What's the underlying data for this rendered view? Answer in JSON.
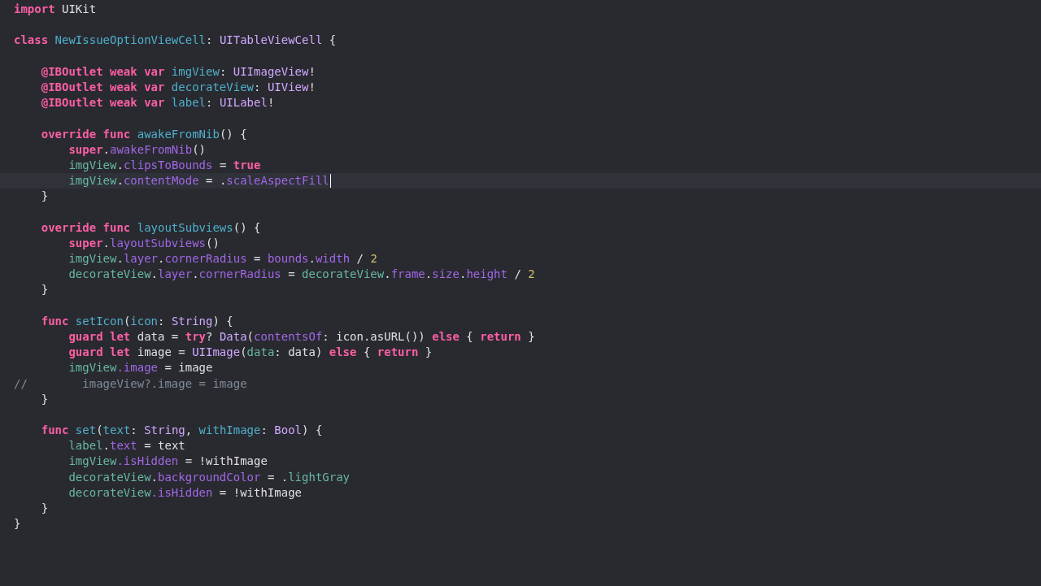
{
  "editor": {
    "lines": [
      {
        "kind": "code",
        "cursor": false,
        "tokens": [
          {
            "text": "import",
            "kind": "kw"
          },
          {
            "text": " UIKit",
            "kind": "plain"
          }
        ]
      },
      {
        "kind": "blank"
      },
      {
        "kind": "code",
        "cursor": false,
        "tokens": [
          {
            "text": "class",
            "kind": "kw"
          },
          {
            "text": " NewIssueOptionViewCell",
            "kind": "decl"
          },
          {
            "text": ": ",
            "kind": "plain"
          },
          {
            "text": "UITableViewCell",
            "kind": "type"
          },
          {
            "text": " {",
            "kind": "plain"
          }
        ]
      },
      {
        "kind": "blank"
      },
      {
        "kind": "code",
        "cursor": false,
        "tokens": [
          {
            "text": "    @IBOutlet weak var",
            "kind": "kw"
          },
          {
            "text": " imgView",
            "kind": "decl"
          },
          {
            "text": ": ",
            "kind": "plain"
          },
          {
            "text": "UIImageView",
            "kind": "type"
          },
          {
            "text": "!",
            "kind": "plain"
          }
        ]
      },
      {
        "kind": "code",
        "cursor": false,
        "tokens": [
          {
            "text": "    @IBOutlet weak var",
            "kind": "kw"
          },
          {
            "text": " decorateView",
            "kind": "decl"
          },
          {
            "text": ": ",
            "kind": "plain"
          },
          {
            "text": "UIView",
            "kind": "type"
          },
          {
            "text": "!",
            "kind": "plain"
          }
        ]
      },
      {
        "kind": "code",
        "cursor": false,
        "tokens": [
          {
            "text": "    @IBOutlet weak var",
            "kind": "kw"
          },
          {
            "text": " label",
            "kind": "decl"
          },
          {
            "text": ": ",
            "kind": "plain"
          },
          {
            "text": "UILabel",
            "kind": "type"
          },
          {
            "text": "!",
            "kind": "plain"
          }
        ]
      },
      {
        "kind": "blank"
      },
      {
        "kind": "code",
        "cursor": false,
        "tokens": [
          {
            "text": "    override func",
            "kind": "kw"
          },
          {
            "text": " awakeFromNib",
            "kind": "decl"
          },
          {
            "text": "() {",
            "kind": "plain"
          }
        ]
      },
      {
        "kind": "code",
        "cursor": false,
        "tokens": [
          {
            "text": "        super",
            "kind": "kw"
          },
          {
            "text": ".",
            "kind": "plain"
          },
          {
            "text": "awakeFromNib",
            "kind": "sys"
          },
          {
            "text": "()",
            "kind": "plain"
          }
        ]
      },
      {
        "kind": "code",
        "cursor": false,
        "tokens": [
          {
            "text": "        imgView",
            "kind": "proj"
          },
          {
            "text": ".",
            "kind": "plain"
          },
          {
            "text": "clipsToBounds",
            "kind": "sys"
          },
          {
            "text": " = ",
            "kind": "plain"
          },
          {
            "text": "true",
            "kind": "kw"
          }
        ]
      },
      {
        "kind": "code",
        "cursor": true,
        "tokens": [
          {
            "text": "        imgView",
            "kind": "proj"
          },
          {
            "text": ".",
            "kind": "plain"
          },
          {
            "text": "contentMode",
            "kind": "sys"
          },
          {
            "text": " = .",
            "kind": "plain"
          },
          {
            "text": "scaleAspectFill",
            "kind": "sys"
          }
        ]
      },
      {
        "kind": "code",
        "cursor": false,
        "tokens": [
          {
            "text": "    }",
            "kind": "plain"
          }
        ]
      },
      {
        "kind": "blank"
      },
      {
        "kind": "code",
        "cursor": false,
        "tokens": [
          {
            "text": "    override func",
            "kind": "kw"
          },
          {
            "text": " layoutSubviews",
            "kind": "decl"
          },
          {
            "text": "() {",
            "kind": "plain"
          }
        ]
      },
      {
        "kind": "code",
        "cursor": false,
        "tokens": [
          {
            "text": "        super",
            "kind": "kw"
          },
          {
            "text": ".",
            "kind": "plain"
          },
          {
            "text": "layoutSubviews",
            "kind": "sys"
          },
          {
            "text": "()",
            "kind": "plain"
          }
        ]
      },
      {
        "kind": "code",
        "cursor": false,
        "tokens": [
          {
            "text": "        imgView",
            "kind": "proj"
          },
          {
            "text": ".",
            "kind": "plain"
          },
          {
            "text": "layer",
            "kind": "sys"
          },
          {
            "text": ".",
            "kind": "plain"
          },
          {
            "text": "cornerRadius",
            "kind": "sys"
          },
          {
            "text": " = ",
            "kind": "plain"
          },
          {
            "text": "bounds",
            "kind": "sys"
          },
          {
            "text": ".",
            "kind": "plain"
          },
          {
            "text": "width",
            "kind": "sys"
          },
          {
            "text": " / ",
            "kind": "plain"
          },
          {
            "text": "2",
            "kind": "num"
          }
        ]
      },
      {
        "kind": "code",
        "cursor": false,
        "tokens": [
          {
            "text": "        decorateView",
            "kind": "proj"
          },
          {
            "text": ".",
            "kind": "plain"
          },
          {
            "text": "layer",
            "kind": "sys"
          },
          {
            "text": ".",
            "kind": "plain"
          },
          {
            "text": "cornerRadius",
            "kind": "sys"
          },
          {
            "text": " = ",
            "kind": "plain"
          },
          {
            "text": "decorateView",
            "kind": "proj"
          },
          {
            "text": ".",
            "kind": "plain"
          },
          {
            "text": "frame",
            "kind": "sys"
          },
          {
            "text": ".",
            "kind": "plain"
          },
          {
            "text": "size",
            "kind": "sys"
          },
          {
            "text": ".",
            "kind": "plain"
          },
          {
            "text": "height",
            "kind": "sys"
          },
          {
            "text": " / ",
            "kind": "plain"
          },
          {
            "text": "2",
            "kind": "num"
          }
        ]
      },
      {
        "kind": "code",
        "cursor": false,
        "tokens": [
          {
            "text": "    }",
            "kind": "plain"
          }
        ]
      },
      {
        "kind": "blank"
      },
      {
        "kind": "code",
        "cursor": false,
        "tokens": [
          {
            "text": "    func",
            "kind": "kw"
          },
          {
            "text": " setIcon",
            "kind": "decl"
          },
          {
            "text": "(",
            "kind": "plain"
          },
          {
            "text": "icon",
            "kind": "decl"
          },
          {
            "text": ": ",
            "kind": "plain"
          },
          {
            "text": "String",
            "kind": "type"
          },
          {
            "text": ") {",
            "kind": "plain"
          }
        ]
      },
      {
        "kind": "code",
        "cursor": false,
        "tokens": [
          {
            "text": "        guard let",
            "kind": "kw"
          },
          {
            "text": " data = ",
            "kind": "plain"
          },
          {
            "text": "try",
            "kind": "kw"
          },
          {
            "text": "? ",
            "kind": "plain"
          },
          {
            "text": "Data",
            "kind": "type"
          },
          {
            "text": "(",
            "kind": "plain"
          },
          {
            "text": "contentsOf",
            "kind": "sys"
          },
          {
            "text": ": icon.asURL()) ",
            "kind": "plain"
          },
          {
            "text": "else",
            "kind": "kw"
          },
          {
            "text": " { ",
            "kind": "plain"
          },
          {
            "text": "return",
            "kind": "kw"
          },
          {
            "text": " }",
            "kind": "plain"
          }
        ]
      },
      {
        "kind": "code",
        "cursor": false,
        "tokens": [
          {
            "text": "        guard let",
            "kind": "kw"
          },
          {
            "text": " image = ",
            "kind": "plain"
          },
          {
            "text": "UIImage",
            "kind": "type"
          },
          {
            "text": "(",
            "kind": "plain"
          },
          {
            "text": "data",
            "kind": "proj"
          },
          {
            "text": ": data) ",
            "kind": "plain"
          },
          {
            "text": "else",
            "kind": "kw"
          },
          {
            "text": " { ",
            "kind": "plain"
          },
          {
            "text": "return",
            "kind": "kw"
          },
          {
            "text": " }",
            "kind": "plain"
          }
        ]
      },
      {
        "kind": "code",
        "cursor": false,
        "tokens": [
          {
            "text": "        imgView",
            "kind": "proj"
          },
          {
            "text": ".image",
            "kind": "sys"
          },
          {
            "text": " = image",
            "kind": "plain"
          }
        ]
      },
      {
        "kind": "code",
        "cursor": false,
        "tokens": [
          {
            "text": "//        imageView?.image = image",
            "kind": "comment"
          }
        ]
      },
      {
        "kind": "code",
        "cursor": false,
        "tokens": [
          {
            "text": "    }",
            "kind": "plain"
          }
        ]
      },
      {
        "kind": "blank"
      },
      {
        "kind": "code",
        "cursor": false,
        "tokens": [
          {
            "text": "    func",
            "kind": "kw"
          },
          {
            "text": " set",
            "kind": "decl"
          },
          {
            "text": "(",
            "kind": "plain"
          },
          {
            "text": "text",
            "kind": "decl"
          },
          {
            "text": ": ",
            "kind": "plain"
          },
          {
            "text": "String",
            "kind": "type"
          },
          {
            "text": ", ",
            "kind": "plain"
          },
          {
            "text": "withImage",
            "kind": "decl"
          },
          {
            "text": ": ",
            "kind": "plain"
          },
          {
            "text": "Bool",
            "kind": "type"
          },
          {
            "text": ") {",
            "kind": "plain"
          }
        ]
      },
      {
        "kind": "code",
        "cursor": false,
        "tokens": [
          {
            "text": "        label",
            "kind": "proj"
          },
          {
            "text": ".",
            "kind": "plain"
          },
          {
            "text": "text",
            "kind": "sys"
          },
          {
            "text": " = text",
            "kind": "plain"
          }
        ]
      },
      {
        "kind": "code",
        "cursor": false,
        "tokens": [
          {
            "text": "        imgView",
            "kind": "proj"
          },
          {
            "text": ".isHidden",
            "kind": "sys"
          },
          {
            "text": " = !withImage",
            "kind": "plain"
          }
        ]
      },
      {
        "kind": "code",
        "cursor": false,
        "tokens": [
          {
            "text": "        decorateView",
            "kind": "proj"
          },
          {
            "text": ".",
            "kind": "plain"
          },
          {
            "text": "backgroundColor",
            "kind": "sys"
          },
          {
            "text": " = .",
            "kind": "plain"
          },
          {
            "text": "lightGray",
            "kind": "proj"
          }
        ]
      },
      {
        "kind": "code",
        "cursor": false,
        "tokens": [
          {
            "text": "        decorateView",
            "kind": "proj"
          },
          {
            "text": ".isHidden",
            "kind": "sys"
          },
          {
            "text": " = !withImage",
            "kind": "plain"
          }
        ]
      },
      {
        "kind": "code",
        "cursor": false,
        "tokens": [
          {
            "text": "    }",
            "kind": "plain"
          }
        ]
      },
      {
        "kind": "code",
        "cursor": false,
        "tokens": [
          {
            "text": "}",
            "kind": "plain"
          }
        ]
      }
    ]
  }
}
